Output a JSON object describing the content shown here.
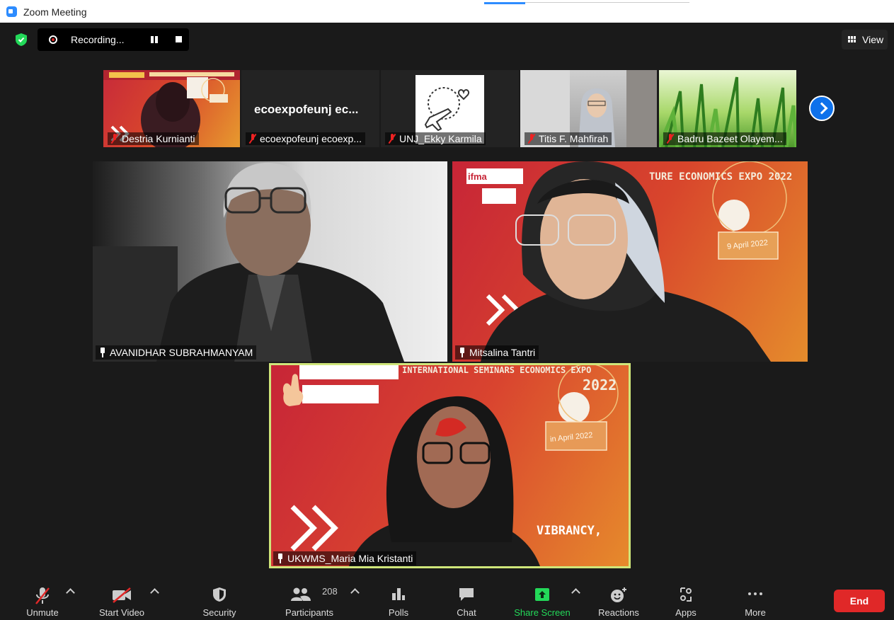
{
  "window": {
    "title": "Zoom Meeting"
  },
  "top_bar": {
    "recording_label": "Recording...",
    "view_label": "View"
  },
  "thumbnails": [
    {
      "name": "Destria Kurnianti",
      "muted": true
    },
    {
      "name": "ecoexpofeunj ecoexp...",
      "display_text": "ecoexpofeunj  ec...",
      "muted": true
    },
    {
      "name": "UNJ_Ekky Karmila",
      "muted": true
    },
    {
      "name": "Titis F. Mahfirah",
      "muted": true
    },
    {
      "name": "Badru Bazeet Olayem...",
      "muted": true
    }
  ],
  "tiles": [
    {
      "name": "AVANIDHAR SUBRAHMANYAM",
      "pinned": true
    },
    {
      "name": "Mitsalina Tantri",
      "pinned": true,
      "background_text": "TURE ECONOMICS EXPO 2022",
      "date_sign": "9 April 2022",
      "logo_text": "ifma"
    },
    {
      "name": "UKWMS_Maria Mia Kristanti",
      "pinned": true,
      "active_speaker": true,
      "background_text_top": "INTERNATIONAL SEMINARS ECONOMICS EXPO",
      "year": "2022",
      "date_sign": "in April 2022",
      "background_text_bottom": "VIBRANCY,"
    }
  ],
  "toolbar": {
    "unmute": "Unmute",
    "start_video": "Start Video",
    "security": "Security",
    "participants": "Participants",
    "participants_count": "208",
    "polls": "Polls",
    "chat": "Chat",
    "share_screen": "Share Screen",
    "reactions": "Reactions",
    "apps": "Apps",
    "more": "More",
    "end": "End"
  },
  "colors": {
    "accent_blue": "#0e71eb",
    "share_green": "#23d959",
    "end_red": "#e02828",
    "speaker_border": "#cfe67a"
  }
}
